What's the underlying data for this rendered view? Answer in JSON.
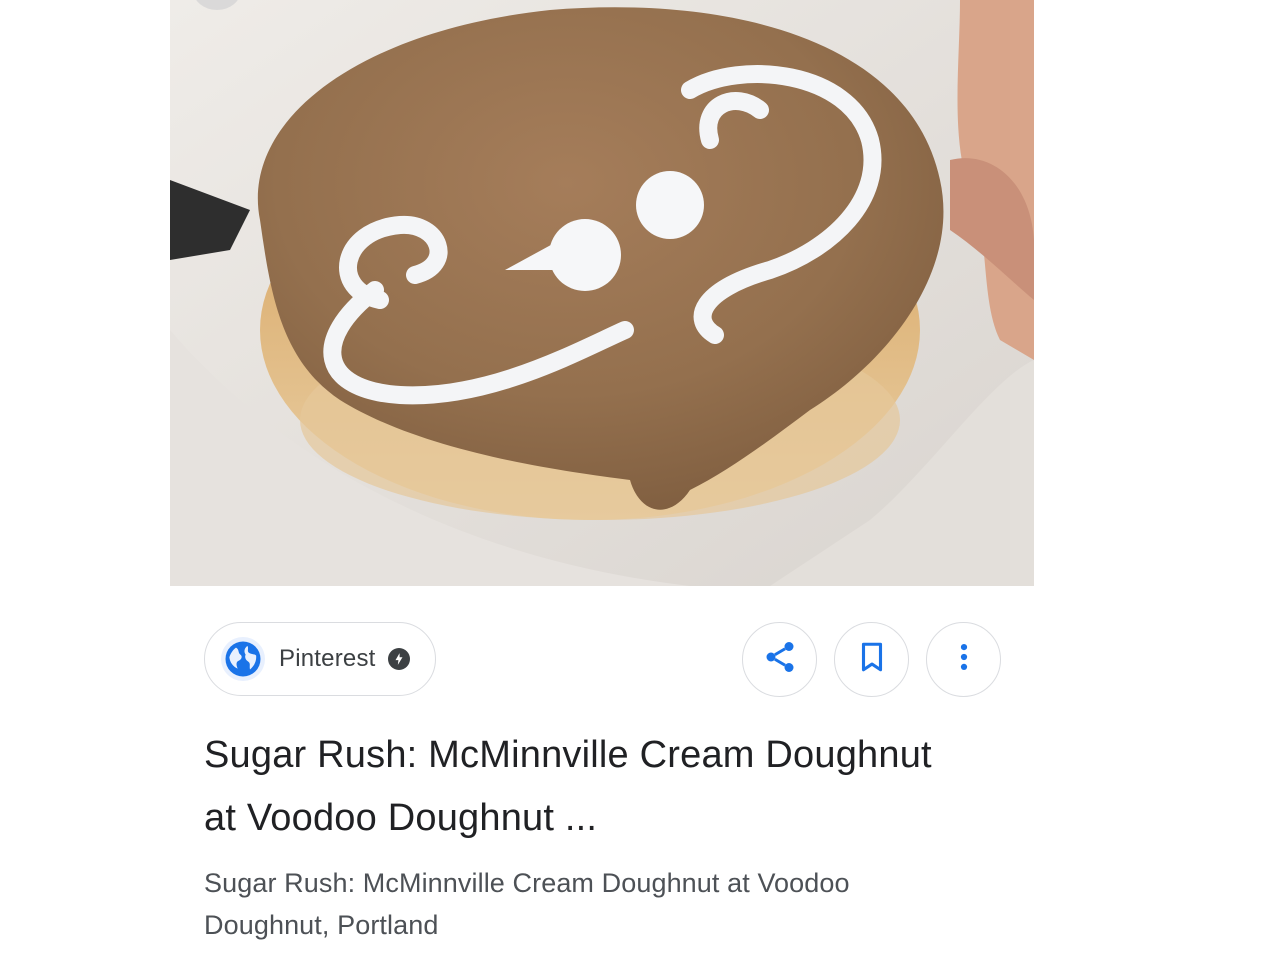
{
  "image": {
    "subject": "maple-glazed-doughnut-photo"
  },
  "source": {
    "name": "Pinterest",
    "icon": "globe-icon",
    "badge_icon": "amp-lightning-icon"
  },
  "actions": {
    "share_icon": "share-icon",
    "save_icon": "bookmark-icon",
    "more_icon": "more-vert-icon"
  },
  "result": {
    "title": "Sugar Rush: McMinnville Cream Doughnut at Voodoo Doughnut ...",
    "description": "Sugar Rush: McMinnville Cream Doughnut at Voodoo Doughnut, Portland"
  },
  "colors": {
    "accent": "#1a73e8",
    "title_text": "#202124",
    "desc_text": "#4d5156",
    "chip_border": "#dadce0"
  }
}
